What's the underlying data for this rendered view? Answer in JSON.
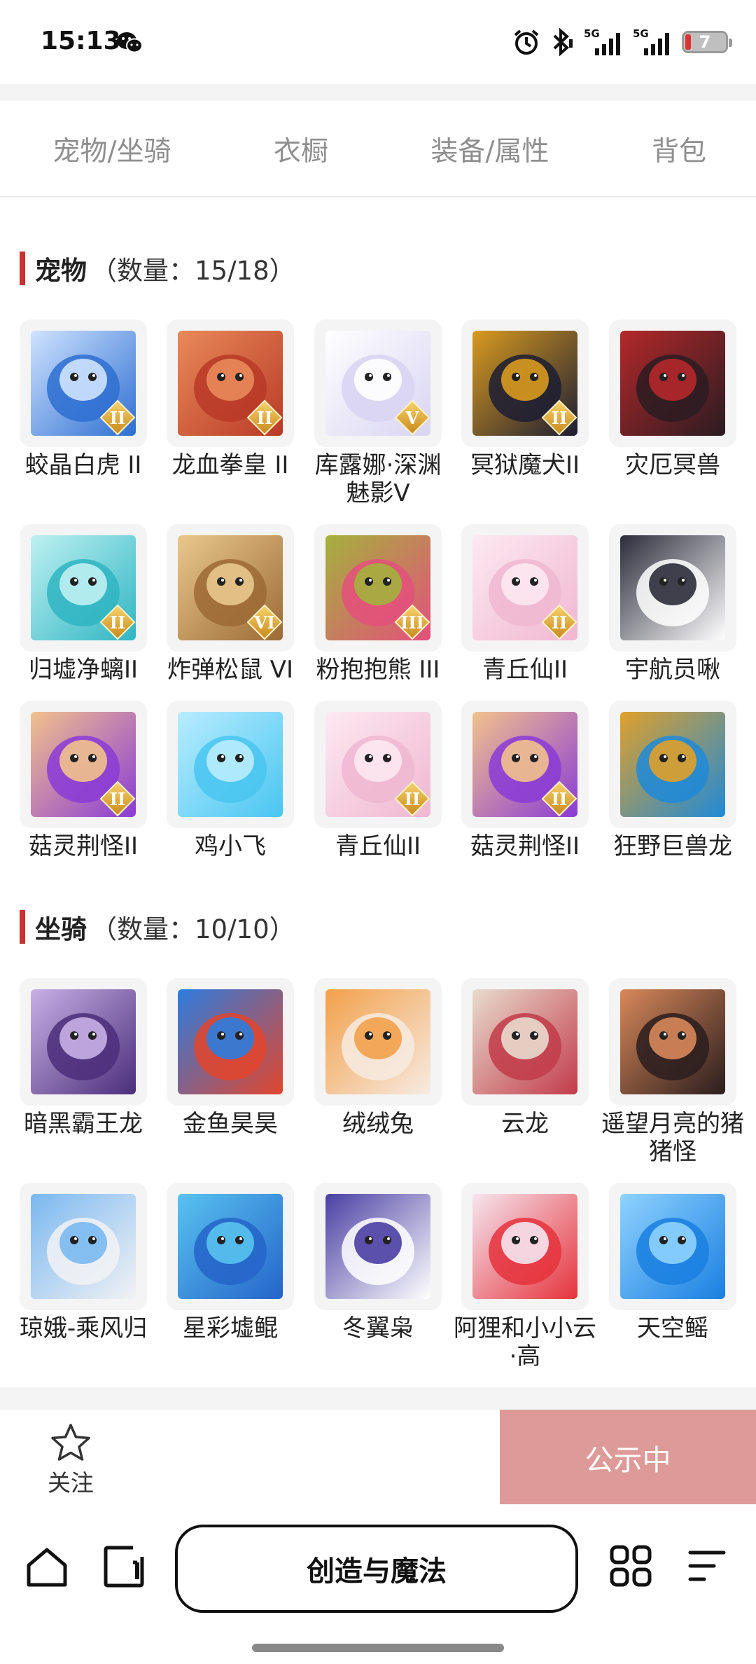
{
  "status_bar": {
    "time": "15:13",
    "battery": "7",
    "icons": [
      "wechat-icon",
      "alarm-icon",
      "bluetooth-icon",
      "signal-5g-icon",
      "signal-5g-icon",
      "battery-icon"
    ]
  },
  "tabs": [
    {
      "label": "宠物/坐骑",
      "active": true
    },
    {
      "label": "衣橱",
      "active": false
    },
    {
      "label": "装备/属性",
      "active": false
    },
    {
      "label": "背包",
      "active": false
    }
  ],
  "pets": {
    "title": "宠物",
    "count": "（数量：15/18）",
    "items": [
      {
        "name": "蛟晶白虎 II",
        "badge": "II",
        "colors": [
          "#2e6fd1",
          "#cfe3ff"
        ]
      },
      {
        "name": "龙血拳皇 II",
        "badge": "II",
        "colors": [
          "#b83a26",
          "#e98a5a"
        ]
      },
      {
        "name": "库露娜·深渊魅影V",
        "badge": "V",
        "colors": [
          "#d8d4f2",
          "#ffffff"
        ]
      },
      {
        "name": "冥狱魔犬II",
        "badge": "II",
        "colors": [
          "#1c1d33",
          "#d99b1f"
        ]
      },
      {
        "name": "灾厄冥兽",
        "badge": "",
        "colors": [
          "#2a1c22",
          "#b4282a"
        ]
      },
      {
        "name": "归墟净螭II",
        "badge": "II",
        "colors": [
          "#2fb5c2",
          "#bff1f2"
        ]
      },
      {
        "name": "炸弹松鼠 VI",
        "badge": "VI",
        "colors": [
          "#9c6a35",
          "#e9c88d"
        ]
      },
      {
        "name": "粉抱抱熊 III",
        "badge": "III",
        "colors": [
          "#e4507d",
          "#a4b13c"
        ]
      },
      {
        "name": "青丘仙II",
        "badge": "II",
        "colors": [
          "#f0b7d1",
          "#fde9f1"
        ]
      },
      {
        "name": "宇航员啾",
        "badge": "",
        "colors": [
          "#ffffff",
          "#2b2c3a"
        ]
      },
      {
        "name": "菇灵荆怪II",
        "badge": "II",
        "colors": [
          "#8a3bd6",
          "#f2c28c"
        ]
      },
      {
        "name": "鸡小飞",
        "badge": "",
        "colors": [
          "#49c6f0",
          "#b9ecff"
        ]
      },
      {
        "name": "青丘仙II",
        "badge": "II",
        "colors": [
          "#f0b7d1",
          "#fde9f1"
        ]
      },
      {
        "name": "菇灵荆怪II",
        "badge": "II",
        "colors": [
          "#8a3bd6",
          "#f2c28c"
        ]
      },
      {
        "name": "狂野巨兽龙",
        "badge": "",
        "colors": [
          "#1f8ad8",
          "#e0a02a"
        ]
      }
    ]
  },
  "mounts": {
    "title": "坐骑",
    "count": "（数量：10/10）",
    "items": [
      {
        "name": "暗黑霸王龙",
        "colors": [
          "#4b2d7a",
          "#c9b0e6"
        ]
      },
      {
        "name": "金鱼昊昊",
        "colors": [
          "#e2452c",
          "#2c7de0"
        ]
      },
      {
        "name": "绒绒兔",
        "colors": [
          "#f7ebe2",
          "#f2a04a"
        ]
      },
      {
        "name": "云龙",
        "colors": [
          "#c23b4a",
          "#e8dccd"
        ]
      },
      {
        "name": "遥望月亮的猪猪怪",
        "colors": [
          "#2a1d1d",
          "#d8885a"
        ]
      },
      {
        "name": "琼娥-乘风归",
        "colors": [
          "#f2f2f4",
          "#7ab8f0"
        ]
      },
      {
        "name": "星彩墟鲲",
        "colors": [
          "#2464c9",
          "#59c3f0"
        ]
      },
      {
        "name": "冬翼枭",
        "colors": [
          "#ffffff",
          "#4a3fa3"
        ]
      },
      {
        "name": "阿狸和小小云·高",
        "colors": [
          "#e5333c",
          "#f6e6ef"
        ]
      },
      {
        "name": "天空鳐",
        "colors": [
          "#1a7fe0",
          "#8fd3ff"
        ]
      }
    ]
  },
  "action_bar": {
    "follow_label": "关注",
    "announce_label": "公示中"
  },
  "bottom_nav": {
    "title": "创造与魔法",
    "icons": [
      "home-icon",
      "tabs-icon",
      "apps-icon",
      "menu-icon"
    ]
  },
  "theme": {
    "accent": "#c8312f",
    "announce_bg": "#de9a98"
  }
}
